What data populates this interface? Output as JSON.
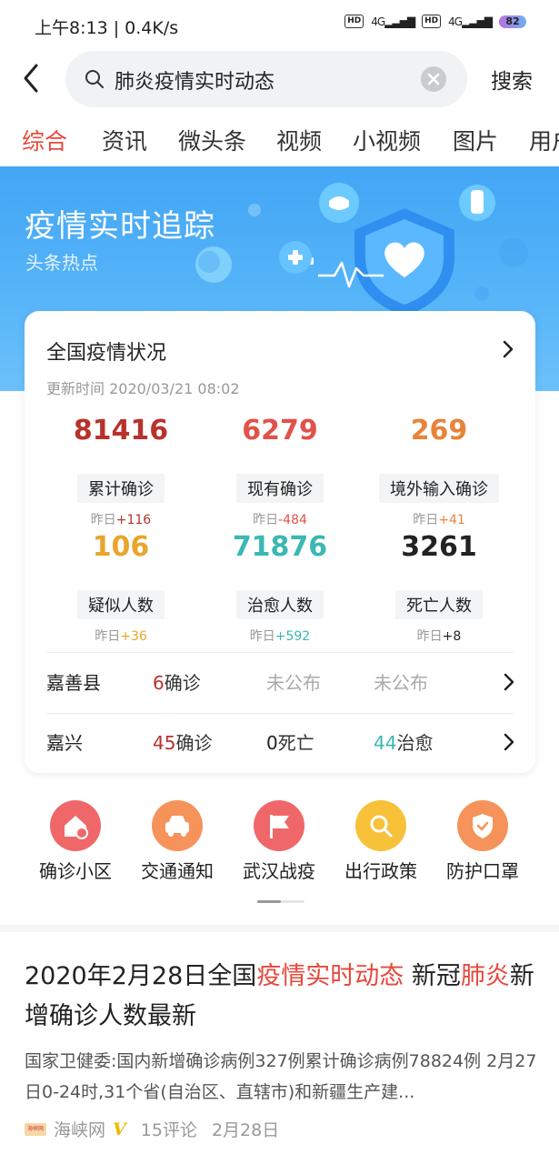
{
  "status_bar": {
    "time": "上午8:13 | 0.4K/s",
    "hd": "HD",
    "net": "4G",
    "battery": "82"
  },
  "search": {
    "query": "肺炎疫情实时动态",
    "button": "搜索"
  },
  "tabs": [
    "综合",
    "资讯",
    "微头条",
    "视频",
    "小视频",
    "图片",
    "用户"
  ],
  "active_tab": 0,
  "banner": {
    "title": "疫情实时追踪",
    "subtitle": "头条热点"
  },
  "card": {
    "title": "全国疫情状况",
    "updated": "更新时间 2020/03/21 08:02",
    "stats": [
      {
        "value": "81416",
        "label": "累计确诊",
        "delta_prefix": "昨日",
        "delta": "+116",
        "color": "#b8322b"
      },
      {
        "value": "6279",
        "label": "现有确诊",
        "delta_prefix": "昨日",
        "delta": "-484",
        "color": "#e0524a"
      },
      {
        "value": "269",
        "label": "境外输入确诊",
        "delta_prefix": "昨日",
        "delta": "+41",
        "color": "#e8843a"
      },
      {
        "value": "106",
        "label": "疑似人数",
        "delta_prefix": "昨日",
        "delta": "+36",
        "color": "#e9a52b"
      },
      {
        "value": "71876",
        "label": "治愈人数",
        "delta_prefix": "昨日",
        "delta": "+592",
        "color": "#3bb8b2"
      },
      {
        "value": "3261",
        "label": "死亡人数",
        "delta_prefix": "昨日",
        "delta": "+8",
        "color": "#222222"
      }
    ],
    "regions": [
      {
        "name": "嘉善县",
        "c1_num": "6",
        "c1_text": "确诊",
        "c2_num": "",
        "c2_text": "未公布",
        "c3_num": "",
        "c3_text": "未公布"
      },
      {
        "name": "嘉兴",
        "c1_num": "45",
        "c1_text": "确诊",
        "c2_num": "0",
        "c2_text": "死亡",
        "c3_num": "44",
        "c3_text": "治愈"
      }
    ]
  },
  "shortcuts": [
    {
      "label": "确诊小区",
      "icon": "home-location-icon",
      "color": "#f0676a"
    },
    {
      "label": "交通通知",
      "icon": "car-icon",
      "color": "#f5935a"
    },
    {
      "label": "武汉战疫",
      "icon": "flag-icon",
      "color": "#f0676a"
    },
    {
      "label": "出行政策",
      "icon": "search-icon",
      "color": "#f7c13a"
    },
    {
      "label": "防护口罩",
      "icon": "shield-check-icon",
      "color": "#f5935a"
    }
  ],
  "article": {
    "title_parts": [
      {
        "text": "2020年2月28日全国",
        "hl": false
      },
      {
        "text": "疫情实时动态",
        "hl": true
      },
      {
        "text": " 新冠",
        "hl": false
      },
      {
        "text": "肺炎",
        "hl": true
      },
      {
        "text": "新增确诊人数最新",
        "hl": false
      }
    ],
    "summary": "国家卫健委:国内新增确诊病例327例累计确诊病例78824例 2月27日0-24时,31个省(自治区、直辖市)和新疆生产建...",
    "logo_text": "海峡网",
    "source": "海峡网",
    "verified": "V",
    "comments": "15评论",
    "date": "2月28日"
  }
}
